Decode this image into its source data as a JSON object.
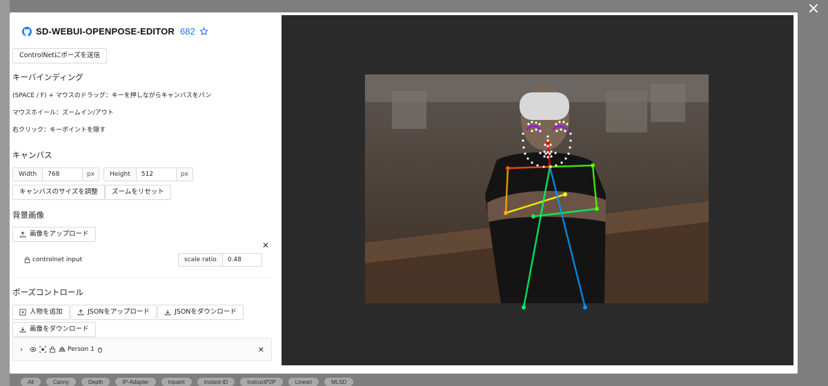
{
  "app": {
    "title": "SD-WEBUI-OPENPOSE-EDITOR",
    "star_count": "682"
  },
  "buttons": {
    "send_pose": "ControlNetにポーズを送信",
    "resize_canvas": "キャンバスのサイズを調整",
    "reset_zoom": "ズームをリセット",
    "upload_image": "画像をアップロード",
    "add_person": "人物を追加",
    "upload_json": "JSONをアップロード",
    "download_json": "JSONをダウンロード",
    "download_image": "画像をダウンロード"
  },
  "keybindings": {
    "heading": "キーバインディング",
    "items": [
      "(SPACE / F) + マウスのドラッグ：キーを押しながらキャンバスをパン",
      "マウスホイール：ズームイン/アウト",
      "右クリック：キーポイントを隠す"
    ]
  },
  "canvas": {
    "heading": "キャンバス",
    "width_label": "Width",
    "width_value": "768",
    "height_label": "Height",
    "height_value": "512",
    "unit": "px"
  },
  "background": {
    "heading": "背景画像",
    "layer_name": "controlnet input",
    "scale_label": "scale ratio",
    "scale_value": "0.48"
  },
  "pose_control": {
    "heading": "ポーズコントロール",
    "person_label": "Person 1"
  },
  "bottom_tabs": [
    "All",
    "Canny",
    "Depth",
    "IP-Adapter",
    "Inpaint",
    "Instant-ID",
    "InstructP2P",
    "Lineart",
    "MLSD"
  ],
  "colors": {
    "accent": "#1677ff",
    "canvas_bg": "#2b2b2b"
  }
}
